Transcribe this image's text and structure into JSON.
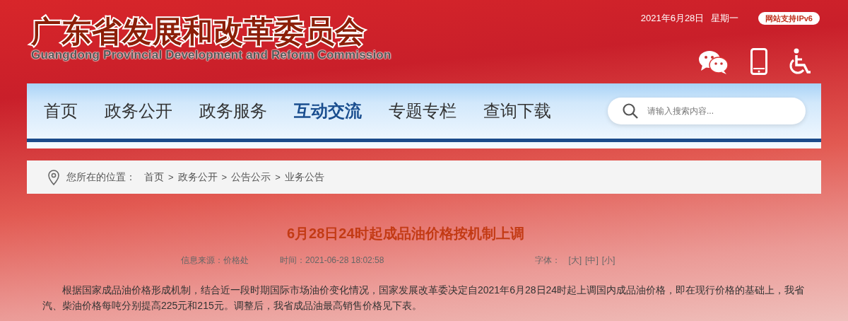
{
  "header": {
    "title": "广东省发展和改革委员会",
    "subtitle": "Guangdong Provincial Development and Reform Commission",
    "date": "2021年6月28日",
    "weekday": "星期一",
    "ipv6_badge": "网站支持IPv6"
  },
  "nav": {
    "items": [
      {
        "label": "首页",
        "selected": false
      },
      {
        "label": "政务公开",
        "selected": false
      },
      {
        "label": "政务服务",
        "selected": false
      },
      {
        "label": "互动交流",
        "selected": true
      },
      {
        "label": "专题专栏",
        "selected": false
      },
      {
        "label": "查询下载",
        "selected": false
      }
    ],
    "search": {
      "placeholder": "请输入搜索内容..."
    }
  },
  "breadcrumb": {
    "label": "您所在的位置：",
    "items": [
      "首页",
      "政务公开",
      "公告公示",
      "业务公告"
    ],
    "separator": ">"
  },
  "article": {
    "title": "6月28日24时起成品油价格按机制上调",
    "source": "信息来源：价格处",
    "time": "时间：2021-06-28 18:02:58",
    "font_label": "字体：",
    "font_sizes": [
      "[大]",
      "[中]",
      "[小]"
    ],
    "paragraph": "根据国家成品油价格形成机制，结合近一段时期国际市场油价变化情况，国家发展改革委决定自2021年6月28日24时起上调国内成品油价格，即在现行价格的基础上，我省汽、柴油价格每吨分别提高225元和215元。调整后，我省成品油最高销售价格见下表。"
  }
}
